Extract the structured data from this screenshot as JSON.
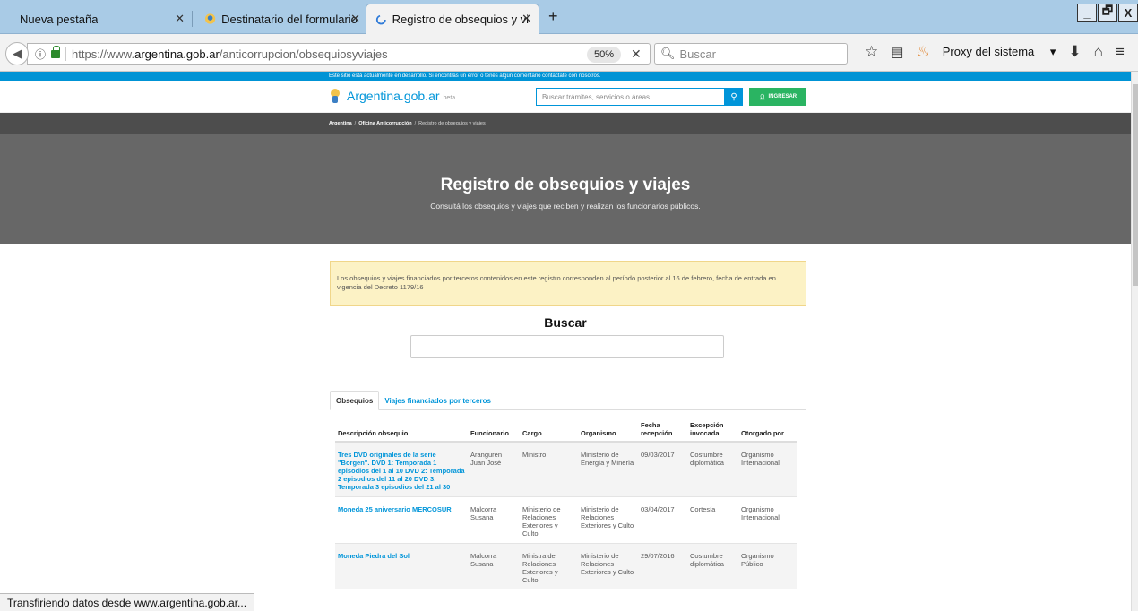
{
  "browser": {
    "tabs": [
      {
        "title": "Nueva pestaña"
      },
      {
        "title": "Destinatario del formulario..."
      },
      {
        "title": "Registro de obsequios y via..."
      }
    ],
    "new_tab": "+",
    "window_controls": [
      "_",
      "🗗",
      "X"
    ],
    "url_prefix": "https://www.",
    "url_domain": "argentina.gob.ar",
    "url_path": "/anticorrupcion/obsequiosyviajes",
    "zoom": "50%",
    "search_placeholder": "Buscar",
    "proxy_label": "Proxy del sistema",
    "status_text": "Transfiriendo datos desde www.argentina.gob.ar..."
  },
  "site": {
    "dev_banner": "Este sitio está actualmente en desarrollo. Si encontrás un error o tenés algún comentario contactate con nosotros.",
    "brand": "Argentina.gob.ar",
    "beta": "beta",
    "search_placeholder": "Buscar trámites, servicios o áreas",
    "login_label": "INGRESAR",
    "breadcrumb": [
      "Argentina",
      "Oficina Anticorrupción",
      "Registro de obsequios y viajes"
    ],
    "hero_title": "Registro de obsequios y viajes",
    "hero_subtitle": "Consultá los obsequios y viajes que reciben y realizan los funcionarios públicos.",
    "notice": "Los obsequios y viajes financiados por terceros contenidos en este registro corresponden al período posterior al 16 de febrero, fecha de entrada en vigencia del Decreto 1179/16",
    "buscar_title": "Buscar",
    "tabs": [
      "Obsequios",
      "Viajes financiados por terceros"
    ],
    "table": {
      "headers": [
        "Descripción obsequio",
        "Funcionario",
        "Cargo",
        "Organismo",
        "Fecha recepción",
        "Excepción invocada",
        "Otorgado por"
      ],
      "rows": [
        [
          "Tres DVD originales de la serie \"Borgen\". DVD 1: Temporada 1 episodios del 1 al 10 DVD 2: Temporada 2 episodios del 11 al 20 DVD 3: Temporada 3 episodios del 21 al 30",
          "Aranguren Juan José",
          "Ministro",
          "Ministerio de Energía y Minería",
          "09/03/2017",
          "Costumbre diplomática",
          "Organismo Internacional"
        ],
        [
          "Moneda 25 aniversario MERCOSUR",
          "Malcorra Susana",
          "Ministerio de Relaciones Exteriores y Culto",
          "Ministerio de Relaciones Exteriores y Culto",
          "03/04/2017",
          "Cortesía",
          "Organismo Internacional"
        ],
        [
          "Moneda Piedra del Sol",
          "Malcorra Susana",
          "Ministra de Relaciones Exteriores y Culto",
          "Ministerio de Relaciones Exteriores y Culto",
          "29/07/2016",
          "Costumbre diplomática",
          "Organismo Público"
        ]
      ]
    }
  }
}
